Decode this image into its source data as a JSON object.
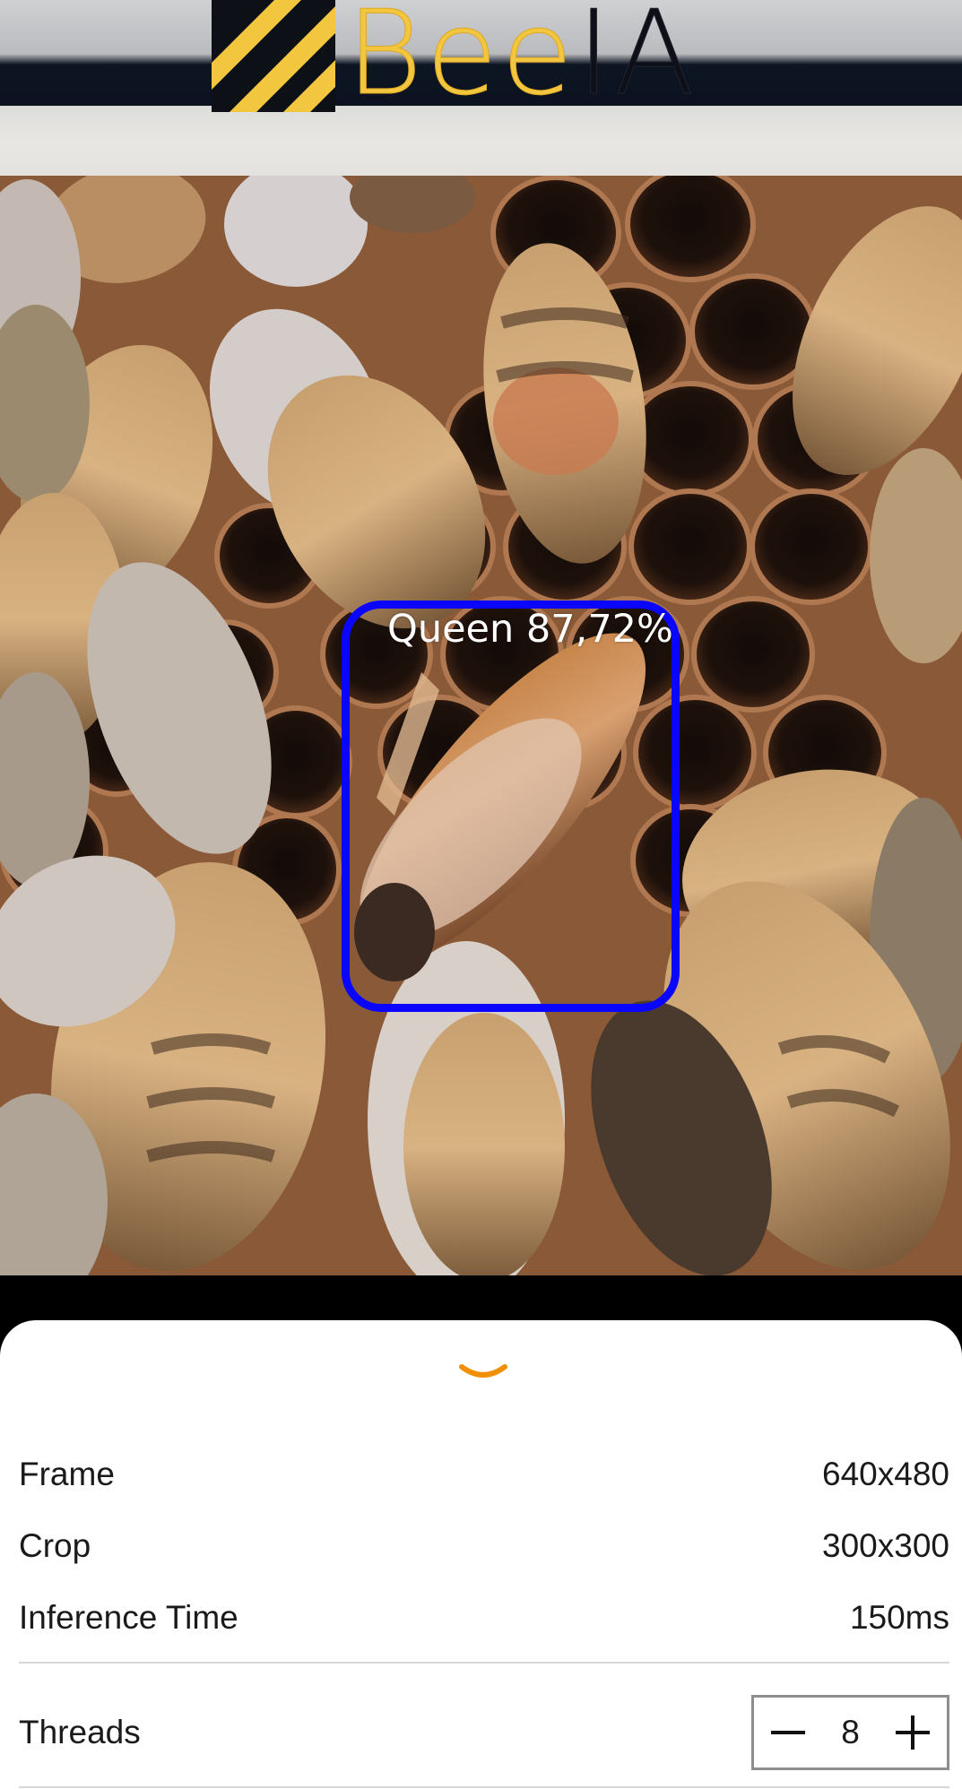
{
  "header": {
    "logo_text_gold": "Bee",
    "logo_text_dark": "IA"
  },
  "detection": {
    "label": "Queen 87,72%",
    "box_color": "#0a05ff"
  },
  "stats": {
    "frame_label": "Frame",
    "frame_value": "640x480",
    "crop_label": "Crop",
    "crop_value": "300x300",
    "inference_label": "Inference Time",
    "inference_value": "150ms"
  },
  "threads": {
    "label": "Threads",
    "value": "8"
  },
  "colors": {
    "accent": "#f09000",
    "logo_gold": "#f3c640"
  },
  "icons": {
    "sheet_handle": "chevron-down-icon",
    "decrement": "minus-icon",
    "increment": "plus-icon"
  }
}
